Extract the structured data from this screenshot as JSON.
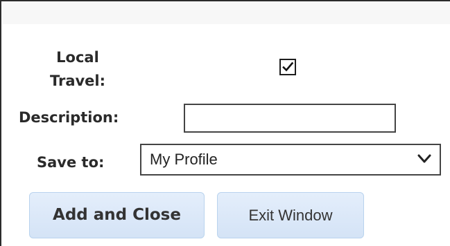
{
  "form": {
    "local_travel": {
      "label_line1": "Local",
      "label_line2": "Travel:",
      "checked": true
    },
    "description": {
      "label": "Description:",
      "value": "",
      "placeholder": ""
    },
    "save_to": {
      "label": "Save to:",
      "selected": "My Profile"
    }
  },
  "buttons": {
    "add_close": "Add and Close",
    "exit_window": "Exit Window"
  },
  "icons": {
    "checkbox_check": "check-icon",
    "dropdown": "chevron-down-icon"
  },
  "colors": {
    "button_fill": "#d4e3f6",
    "button_border": "#b9d3ee",
    "label_text": "#2a2a2a"
  }
}
